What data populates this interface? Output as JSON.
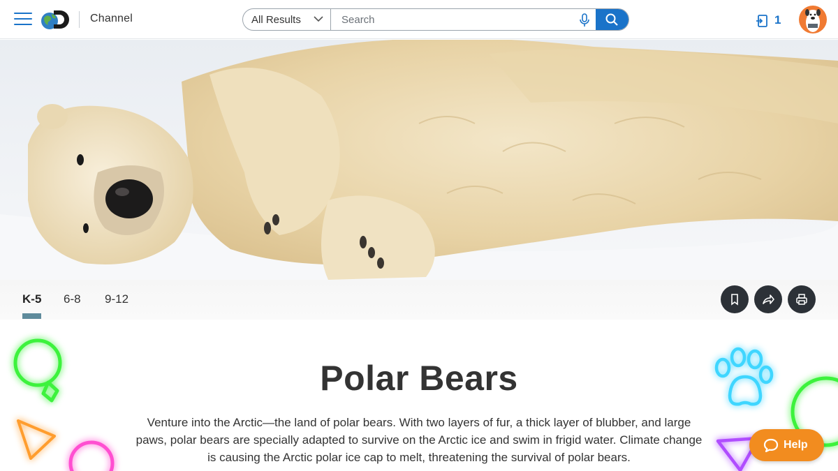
{
  "header": {
    "logo_text": "Channel",
    "search": {
      "scope_label": "All Results",
      "placeholder": "Search"
    },
    "assignments_count": "1"
  },
  "hero": {
    "subject": "polar bear lying in snow"
  },
  "grade_tabs": [
    {
      "label": "K-5",
      "active": true
    },
    {
      "label": "6-8",
      "active": false
    },
    {
      "label": "9-12",
      "active": false
    }
  ],
  "actions": [
    "bookmark-icon",
    "share-icon",
    "print-icon"
  ],
  "content": {
    "title": "Polar Bears",
    "description": "Venture into the Arctic—the land of polar bears. With two layers of fur, a thick layer of blubber, and large paws, polar bears are specially adapted to survive on the Arctic ice and swim in frigid water. Climate change is causing the Arctic polar ice cap to melt, threatening the survival of polar bears."
  },
  "help": {
    "label": "Help"
  },
  "colors": {
    "accent_blue": "#1a73c9",
    "help_orange": "#f28c1f",
    "action_dark": "#2c3137",
    "tab_underline": "#5f8b9c"
  }
}
